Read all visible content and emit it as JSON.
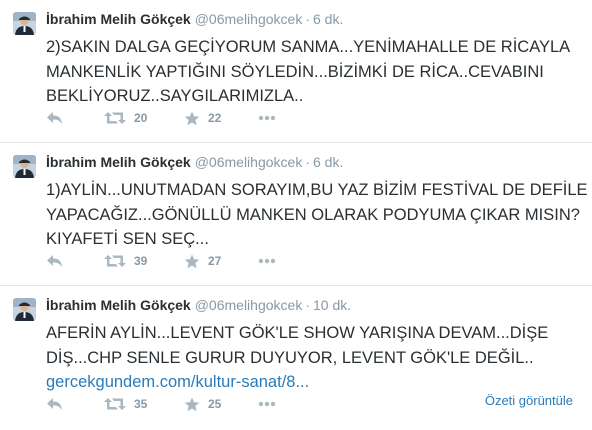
{
  "tweets": [
    {
      "name": "İbrahim Melih Gökçek",
      "handle": "@06melihgokcek",
      "time": "6 dk.",
      "lines": [
        "2)SAKIN DALGA GEÇİYORUM SANMA...YENİMAHALLE DE RİCAYLA",
        "MANKENLİK YAPTIĞINI SÖYLEDİN...BİZİMKİ DE RİCA..CEVABINI",
        "BEKLİYORUZ..SAYGILARIMIZLA.."
      ],
      "retweets": "20",
      "favorites": "22"
    },
    {
      "name": "İbrahim Melih Gökçek",
      "handle": "@06melihgokcek",
      "time": "6 dk.",
      "lines": [
        "1)AYLİN...UNUTMADAN SORAYIM,BU YAZ BİZİM FESTİVAL DE DEFİLE",
        "YAPACAĞIZ...GÖNÜLLÜ MANKEN OLARAK PODYUMA ÇIKAR MISIN?",
        "KIYAFETİ SEN SEÇ..."
      ],
      "retweets": "39",
      "favorites": "27"
    },
    {
      "name": "İbrahim Melih Gökçek",
      "handle": "@06melihgokcek",
      "time": "10 dk.",
      "lines": [
        "AFERİN AYLİN...LEVENT GÖK'LE SHOW YARIŞINA DEVAM...DİŞE",
        "DİŞ...CHP SENLE GURUR DUYUYOR, LEVENT GÖK'LE DEĞİL.."
      ],
      "link": "gercekgundem.com/kultur-sanat/8...",
      "summary_label": "Özeti görüntüle",
      "retweets": "35",
      "favorites": "25"
    }
  ],
  "separator": "·",
  "icons": {
    "reply": "reply-icon",
    "retweet": "retweet-icon",
    "favorite": "star-icon",
    "more": "more-dots-icon",
    "avatar": "profile-photo"
  },
  "colors": {
    "name": "#292f33",
    "muted": "#8899a6",
    "icon": "#aab8c2",
    "link": "#2b7bb9",
    "divider": "#e1e8ed"
  }
}
